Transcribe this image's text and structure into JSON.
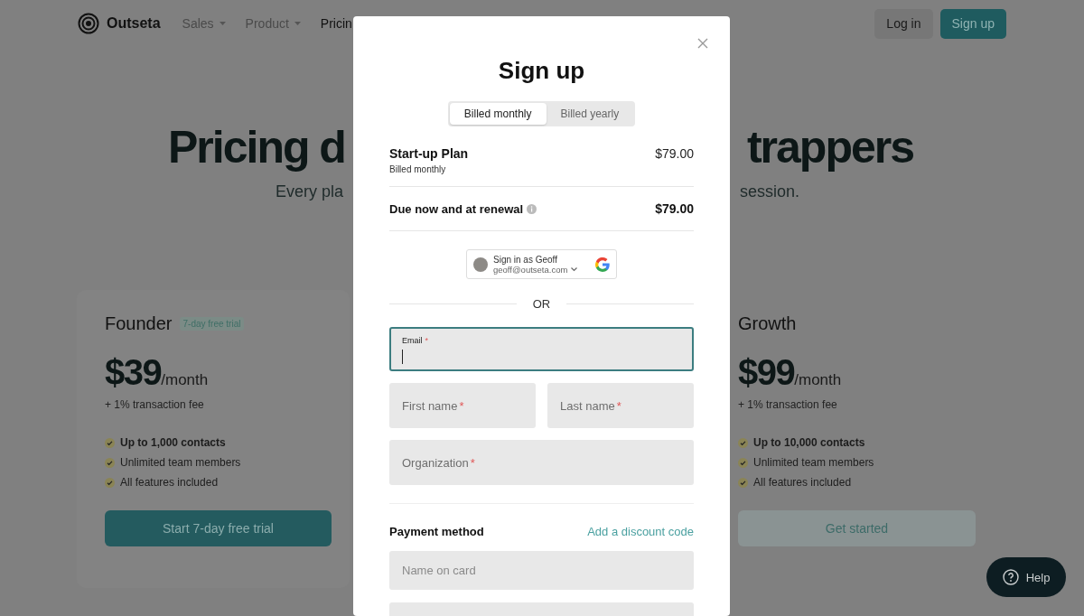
{
  "nav": {
    "logo": "Outseta",
    "items": [
      {
        "label": "Sales",
        "dropdown": true
      },
      {
        "label": "Product",
        "dropdown": true
      },
      {
        "label": "Pricin",
        "dropdown": false
      }
    ],
    "buttons": [
      {
        "label": "Log in",
        "kind": "secondary"
      },
      {
        "label": "Sign up",
        "kind": "primary"
      }
    ]
  },
  "hero": {
    "title_left": "Pricing d",
    "title_right": "trappers",
    "subtitle_left": "Every pla",
    "subtitle_right": "session."
  },
  "plans": [
    {
      "name": "Founder",
      "badge": "7-day free trial",
      "price": "$39",
      "period": "/month",
      "fee": "+ 1% transaction fee",
      "features": [
        {
          "text": "Up to 1,000 contacts",
          "bold": true
        },
        {
          "text": "Unlimited team members",
          "bold": false
        },
        {
          "text": "All features included",
          "bold": false
        }
      ],
      "button": {
        "label": "Start 7-day free trial",
        "kind": "primary"
      }
    },
    {
      "name": "Growth",
      "price": "$99",
      "period": "/month",
      "fee": "+ 1% transaction fee",
      "features": [
        {
          "text": "Up to 10,000 contacts",
          "bold": true
        },
        {
          "text": "Unlimited team members",
          "bold": false
        },
        {
          "text": "All features included",
          "bold": false
        }
      ],
      "button": {
        "label": "Get started",
        "kind": "secondary"
      }
    }
  ],
  "help_button": {
    "label": "Help"
  },
  "modal": {
    "title": "Sign up",
    "billing_tabs": [
      {
        "label": "Billed monthly",
        "selected": true
      },
      {
        "label": "Billed yearly",
        "selected": false
      }
    ],
    "plan": {
      "name": "Start-up Plan",
      "billing": "Billed monthly",
      "price": "$79.00"
    },
    "due": {
      "label": "Due now and at renewal",
      "amount": "$79.00"
    },
    "google_button": {
      "title": "Sign in as Geoff",
      "email": "geoff@outseta.com"
    },
    "divider_text": "OR",
    "fields": [
      {
        "kind": "full",
        "label": "Email",
        "required_mark": "*",
        "focused": true
      },
      {
        "kind": "half",
        "label": "First name",
        "required_mark": "*",
        "focused": false
      },
      {
        "kind": "half",
        "label": "Last name",
        "required_mark": "*",
        "focused": false
      },
      {
        "kind": "full",
        "label": "Organization",
        "required_mark": "*",
        "focused": false
      }
    ],
    "payment": {
      "title": "Payment method",
      "link": "Add a discount code",
      "fields": [
        {
          "kind": "input",
          "placeholder": "Name on card"
        },
        {
          "kind": "input"
        }
      ]
    }
  }
}
